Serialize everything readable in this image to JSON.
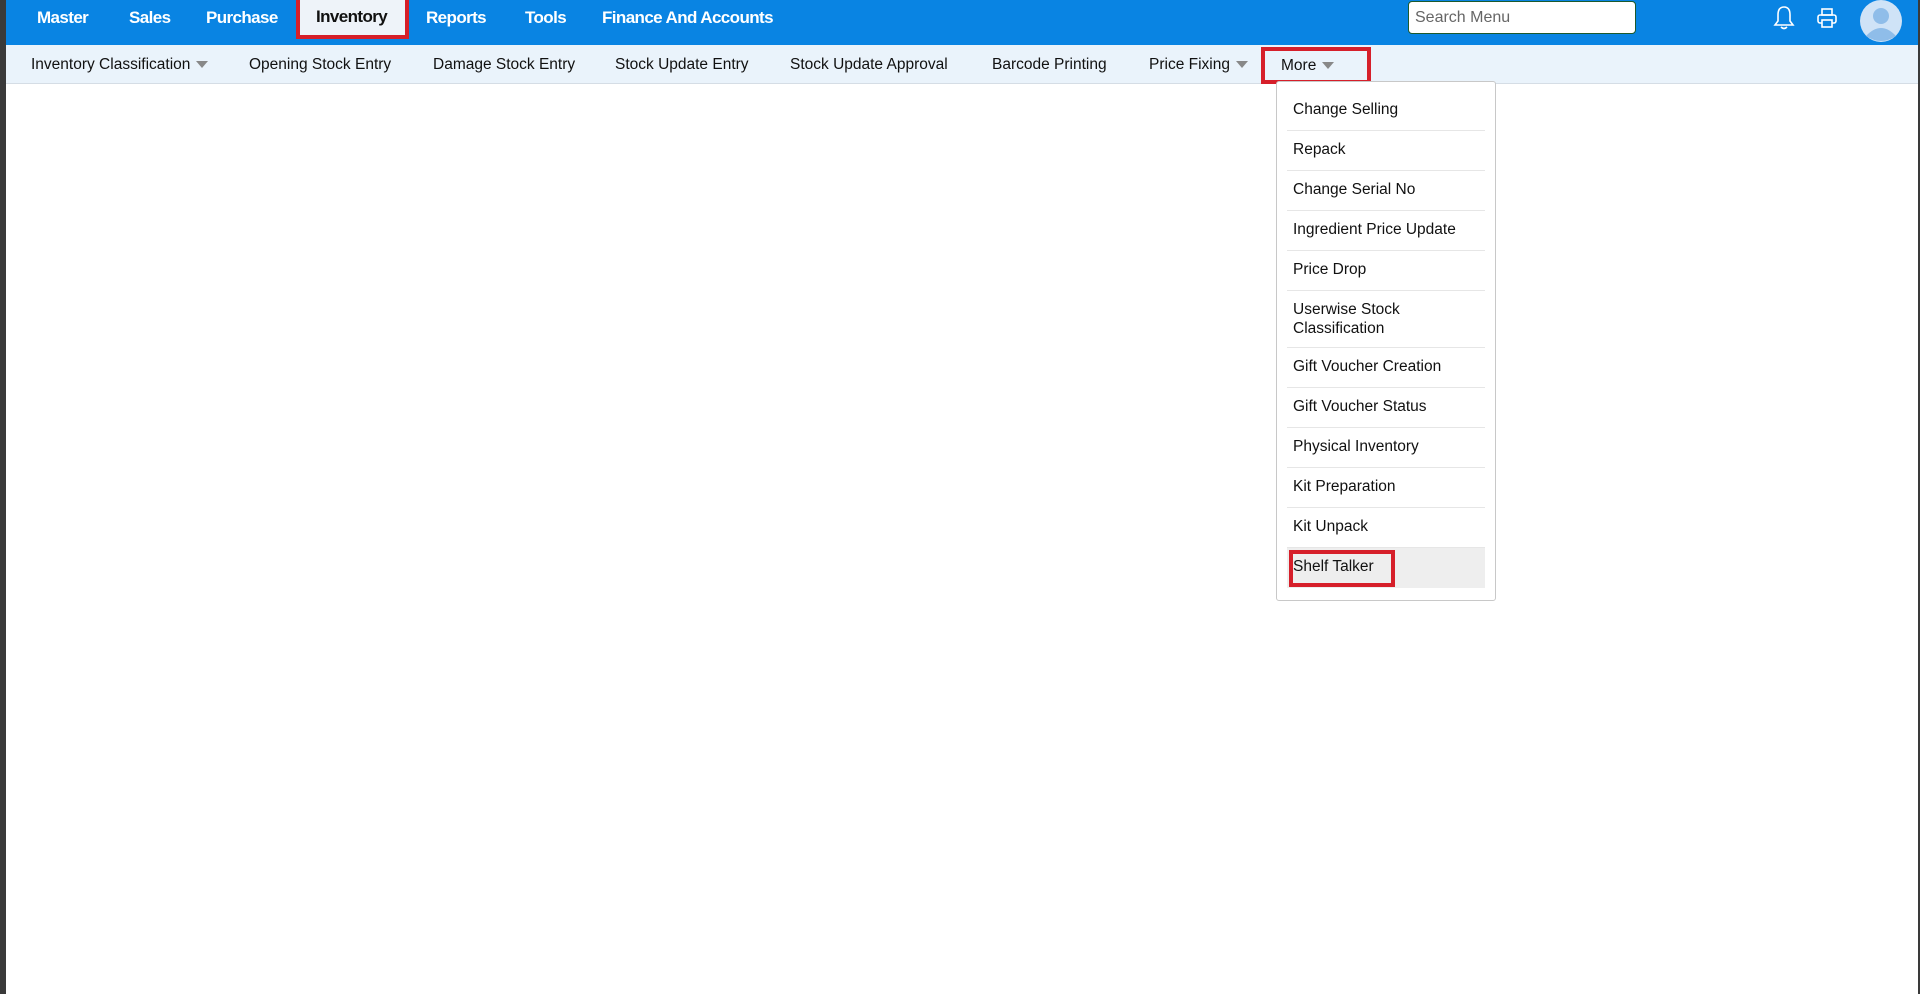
{
  "top_nav": {
    "items": [
      "Master",
      "Sales",
      "Purchase",
      "Inventory",
      "Reports",
      "Tools",
      "Finance And Accounts"
    ],
    "active": "Inventory"
  },
  "search": {
    "placeholder": "Search Menu",
    "value": ""
  },
  "icons": [
    "bell-icon",
    "printer-icon",
    "avatar-icon"
  ],
  "sub_nav": {
    "items": [
      "Inventory Classification",
      "Opening Stock Entry",
      "Damage Stock Entry",
      "Stock Update Entry",
      "Stock Update Approval",
      "Barcode Printing",
      "Price Fixing"
    ],
    "more_label": "More"
  },
  "more_menu": {
    "items": [
      "Change Selling",
      "Repack",
      "Change Serial No",
      "Ingredient Price Update",
      "Price Drop",
      "Userwise Stock Classification",
      "Gift Voucher Creation",
      "Gift Voucher Status",
      "Physical Inventory",
      "Kit Preparation",
      "Kit Unpack",
      "Shelf Talker"
    ],
    "highlighted": "Shelf Talker"
  },
  "colors": {
    "topbar": "#0984e3",
    "subbar": "#eaf3fb",
    "highlight_box": "#d61f2a"
  }
}
